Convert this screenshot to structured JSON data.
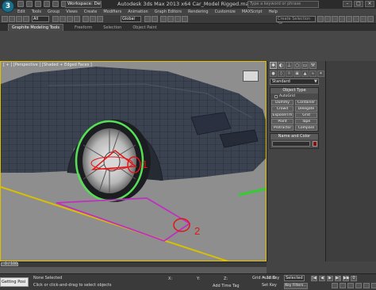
{
  "title_bar": {
    "workspace_label": "Workspace: Default",
    "app_title": "Autodesk 3ds Max  2013 x64      Car_Model Rigged.max",
    "search_placeholder": "Type a keyword or phrase",
    "logo": "3"
  },
  "menu_bar": [
    "Edit",
    "Tools",
    "Group",
    "Views",
    "Create",
    "Modifiers",
    "Animation",
    "Graph Editors",
    "Rendering",
    "Customize",
    "MAXScript",
    "Help"
  ],
  "toolbar": {
    "selection_filter": "All",
    "reference_coord": "Global",
    "named_selection": "Create Selection Se"
  },
  "ribbon": {
    "tabs": [
      "Graphite Modeling Tools",
      "Freeform",
      "Selection",
      "Object Paint"
    ],
    "active_tab_index": 0
  },
  "viewport": {
    "label": "[ + ] [Perspective ] [Shaded + Edged Faces ]",
    "annotation_1": "1",
    "annotation_2": "2"
  },
  "command_panel": {
    "category_dropdown": "Standard",
    "object_type_title": "Object Type",
    "autogrid_label": "AutoGrid",
    "object_buttons": [
      "Dummy",
      "Container",
      "Crowd",
      "Delegate",
      "Expose/Tm",
      "Grid",
      "Point",
      "Tape",
      "Protractor",
      "Compass"
    ],
    "name_color_title": "Name and Color",
    "name_value": "",
    "object_color": "#8a1010"
  },
  "time_slider": {
    "label": "0 / 100"
  },
  "status_bar": {
    "script_box": "Getting Posi",
    "selection_status": "None Selected",
    "prompt": "Click or click-and-drag to select objects",
    "x_label": "X:",
    "y_label": "Y:",
    "z_label": "Z:",
    "grid": "Grid = 10.0",
    "add_time_tag": "Add Time Tag",
    "auto_key": "Auto Key",
    "selected_dropdown": "Selected",
    "set_key": "Set Key",
    "key_filters": "Key Filters...",
    "frame_number": "0"
  },
  "colors": {
    "viewport_bg": "#8e8e8e",
    "car_body": "#3b4250",
    "wheel_select": "#55e055",
    "gizmo_box": "#c030c0",
    "annotation_red": "#e01818",
    "ground_line": "#d8c000",
    "grid_green": "#33cc33"
  }
}
